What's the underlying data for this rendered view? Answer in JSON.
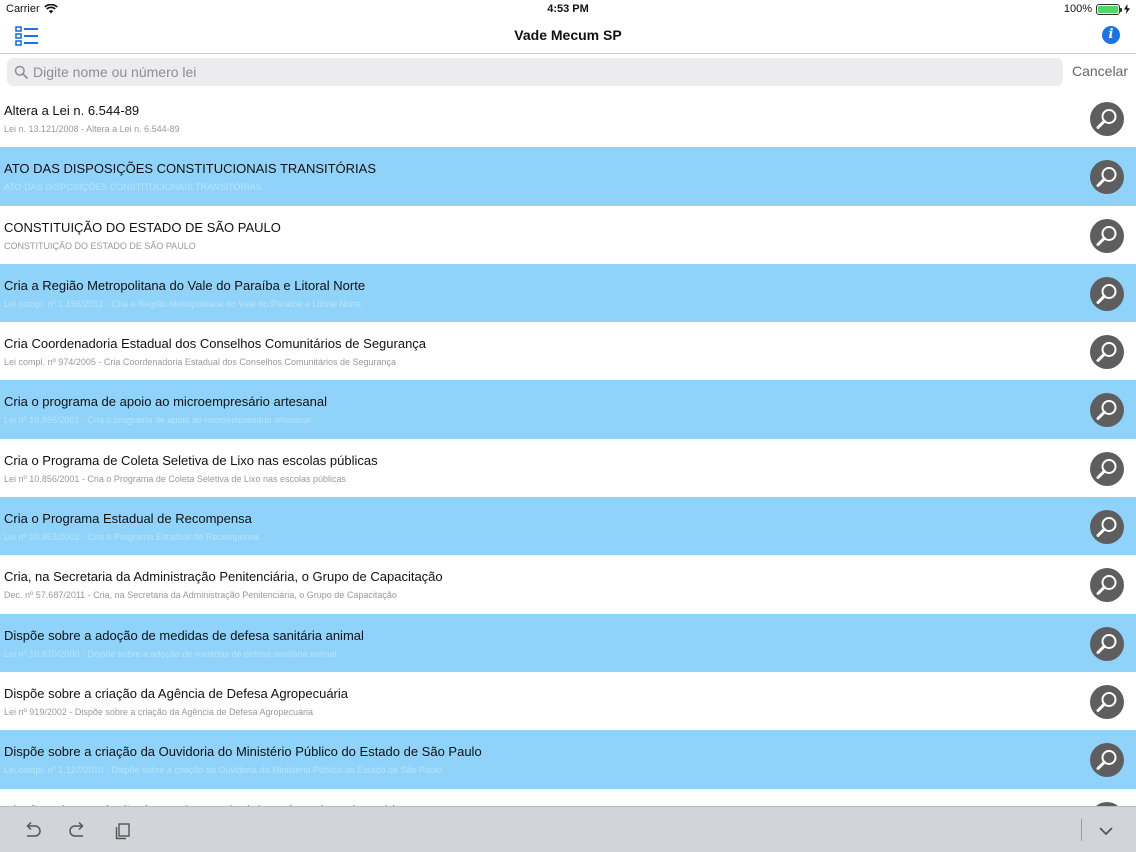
{
  "status": {
    "carrier": "Carrier",
    "time": "4:53 PM",
    "battery": "100%",
    "battery_level": 1.0
  },
  "nav": {
    "title": "Vade Mecum SP",
    "left_icon": "list-icon",
    "right_icon": "info-icon",
    "info_glyph": "i"
  },
  "search": {
    "placeholder": "Digite nome ou número lei",
    "value": "",
    "cancel_label": "Cancelar"
  },
  "items": [
    {
      "title": "Altera a Lei n. 6.544-89",
      "subtitle": "Lei n. 13.121/2008 - Altera a Lei n. 6.544-89"
    },
    {
      "title": "ATO DAS DISPOSIÇÕES CONSTITUCIONAIS TRANSITÓRIAS",
      "subtitle": "ATO DAS DISPOSIÇÕES CONSTITUCIONAIS TRANSITÓRIAS"
    },
    {
      "title": "CONSTITUIÇÃO DO ESTADO DE SÃO PAULO",
      "subtitle": "CONSTITUIÇÃO DO ESTADO DE SÃO PAULO"
    },
    {
      "title": "Cria a Região Metropolitana do Vale do Paraíba e Litoral Norte",
      "subtitle": "Lei compl. nº 1.166/2012 - Cria a Região Metropolitana do Vale do Paraíba e Litoral Norte"
    },
    {
      "title": "Cria Coordenadoria Estadual dos Conselhos Comunitários de Segurança",
      "subtitle": "Lei compl. nº 974/2005 - Cria Coordenadoria Estadual dos Conselhos Comunitários de Segurança"
    },
    {
      "title": "Cria o programa de apoio ao microempresário artesanal",
      "subtitle": "Lei nº 10.866/2001 - Cria o programa de apoio ao microempresário artesanal"
    },
    {
      "title": "Cria o Programa de Coleta Seletiva de Lixo nas escolas públicas",
      "subtitle": "Lei nº 10.856/2001 - Cria o Programa de Coleta Seletiva de Lixo nas escolas públicas"
    },
    {
      "title": "Cria o Programa Estadual de Recompensa",
      "subtitle": "Lei nº 10.953/2001 - Cria o Programa Estadual de Recompensa"
    },
    {
      "title": "Cria, na Secretaria da Administração Penitenciária, o Grupo de Capacitação",
      "subtitle": "Dec. nº 57.687/2011 - Cria, na Secretaria da Administração Penitenciária, o Grupo de Capacitação"
    },
    {
      "title": "Dispõe sobre a adoção de medidas de defesa sanitária animal",
      "subtitle": "Lei nº 10.670/2000 - Dispõe sobre a adoção de medidas de defesa sanitária animal"
    },
    {
      "title": "Dispõe sobre a criação da Agência de Defesa Agropecuária",
      "subtitle": "Lei nº 919/2002 - Dispõe sobre a criação da Agência de Defesa Agropecuária"
    },
    {
      "title": "Dispõe sobre a criação da Ouvidoria do Ministério Público do Estado de São Paulo",
      "subtitle": "Lei compl. nº 1.127/2010 - Dispõe sobre a criação da Ouvidoria do Ministério Público do Estado de São Paulo"
    },
    {
      "title": "Dispõe sobre a criação do Fundo Estadual de Defesa do Meio Ambiente",
      "subtitle": ""
    }
  ],
  "row_colors": {
    "even": "#ffffff",
    "odd": "#8fd3fa"
  },
  "toolbar": {
    "undo_icon": "undo-icon",
    "redo_icon": "redo-icon",
    "paste_icon": "clipboard-icon",
    "dismiss_icon": "chevron-down-icon"
  }
}
